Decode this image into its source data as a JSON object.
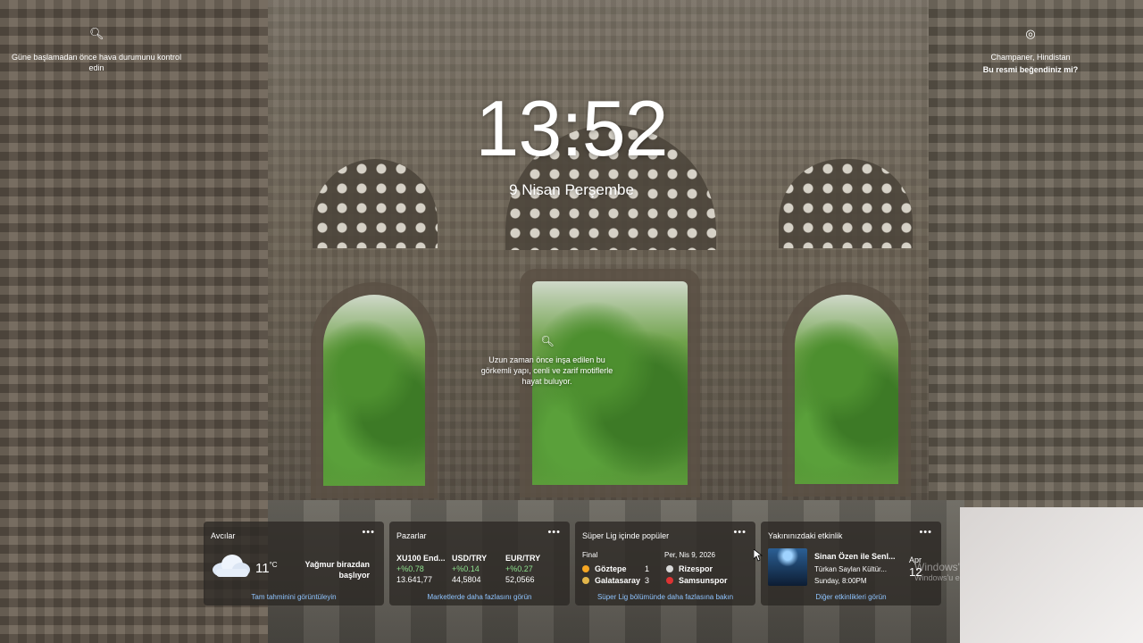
{
  "top_left": {
    "text": "Güne başlamadan önce hava durumunu kontrol edin",
    "icon": "search-icon"
  },
  "top_right": {
    "location": "Champaner, Hindistan",
    "question": "Bu resmi beğendiniz mi?",
    "icon": "location-pin-icon"
  },
  "clock": {
    "time": "13:52",
    "date": "9 Nisan Perşembe"
  },
  "hotspot": {
    "text": "Uzun zaman önce inşa edilen bu görkemli yapı, cenli ve zarif motiflerle hayat buluyor.",
    "icon": "search-icon"
  },
  "widgets": {
    "weather": {
      "title": "Avcılar",
      "temp": "11",
      "unit": "°C",
      "desc": "Yağmur birazdan başlıyor",
      "footer": "Tam tahminini görüntüleyin"
    },
    "markets": {
      "title": "Pazarlar",
      "items": [
        {
          "name": "XU100 End...",
          "change": "+%0.78",
          "value": "13.641,77"
        },
        {
          "name": "USD/TRY",
          "change": "+%0.14",
          "value": "44,5804"
        },
        {
          "name": "EUR/TRY",
          "change": "+%0.27",
          "value": "52,0566"
        }
      ],
      "footer": "Marketlerde daha fazlasını görün"
    },
    "sports": {
      "title": "Süper Lig içinde popüler",
      "status": "Final",
      "date": "Per, Nis 9, 2026",
      "home1": "Göztepe",
      "score1": "1",
      "away1": "Rizespor",
      "home2": "Galatasaray",
      "score2": "3",
      "away2": "Samsunspor",
      "footer": "Süper Lig bölümünde daha fazlasına bakın"
    },
    "events": {
      "title": "Yakınınızdaki etkinlik",
      "event": "Sinan Özen ile Senl...",
      "venue": "Türkan Saylan Kültür...",
      "time": "Sunday, 8:00PM",
      "footer": "Diğer etkinlikleri görün"
    }
  },
  "peek": {
    "month": "Apr",
    "day": "12"
  },
  "watermark": {
    "line1": "Windows'",
    "line2": "Windows'u e"
  },
  "more_label": "•••"
}
